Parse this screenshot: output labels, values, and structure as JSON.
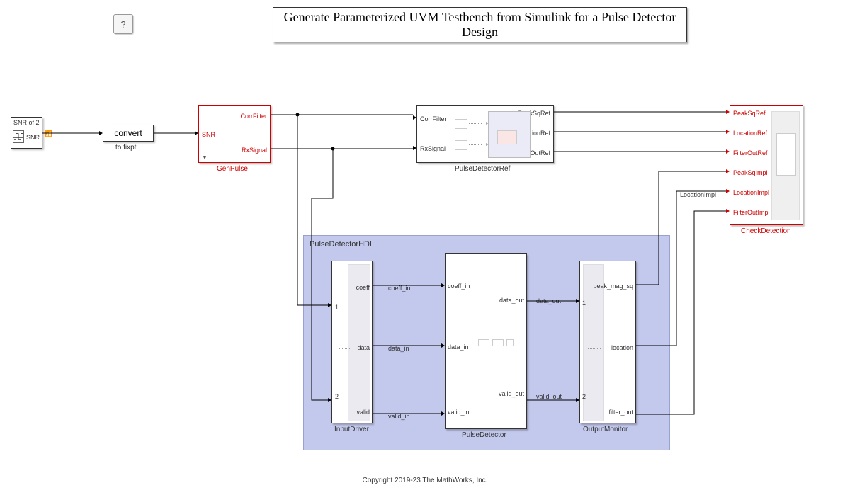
{
  "title": "Generate Parameterized UVM Testbench from Simulink for a Pulse Detector Design",
  "help": "?",
  "footer": "Copyright 2019-23 The MathWorks, Inc.",
  "snr_source": {
    "title": "SNR of 2",
    "out": "SNR"
  },
  "convert": {
    "label": "convert",
    "caption": "to fixpt"
  },
  "genpulse": {
    "caption": "GenPulse",
    "in": "SNR",
    "out1": "CorrFilter",
    "out2": "RxSignal"
  },
  "refdet": {
    "caption": "PulseDetectorRef",
    "in1": "CorrFilter",
    "in2": "RxSignal",
    "out1": "PeakSqRef",
    "out2": "LocationRef",
    "out3": "FilterOutRef"
  },
  "checkdet": {
    "caption": "CheckDetection",
    "p1": "PeakSqRef",
    "p2": "LocationRef",
    "p3": "FilterOutRef",
    "p4": "PeakSqImpl",
    "p5": "LocationImpl",
    "p6": "FilterOutImpl"
  },
  "hdl": {
    "region": "PulseDetectorHDL",
    "driver": {
      "caption": "InputDriver",
      "in1": "1",
      "in2": "2",
      "lbl_coeff": "coeff",
      "lbl_data": "data",
      "lbl_valid": "valid"
    },
    "driver_sigs": {
      "coeff": "coeff_in",
      "data": "data_in",
      "valid": "valid_in"
    },
    "detector": {
      "caption": "PulseDetector",
      "in_coeff": "coeff_in",
      "in_data": "data_in",
      "in_valid": "valid_in",
      "out_data": "data_out",
      "out_valid": "valid_out"
    },
    "detector_sigs": {
      "data": "data_out",
      "valid": "valid_out"
    },
    "monitor": {
      "caption": "OutputMonitor",
      "in1": "1",
      "in2": "2",
      "lbl_peak": "peak_mag_sq",
      "lbl_loc": "location",
      "lbl_filt": "filter_out"
    },
    "monitor_out_sig": "LocationImpl"
  }
}
